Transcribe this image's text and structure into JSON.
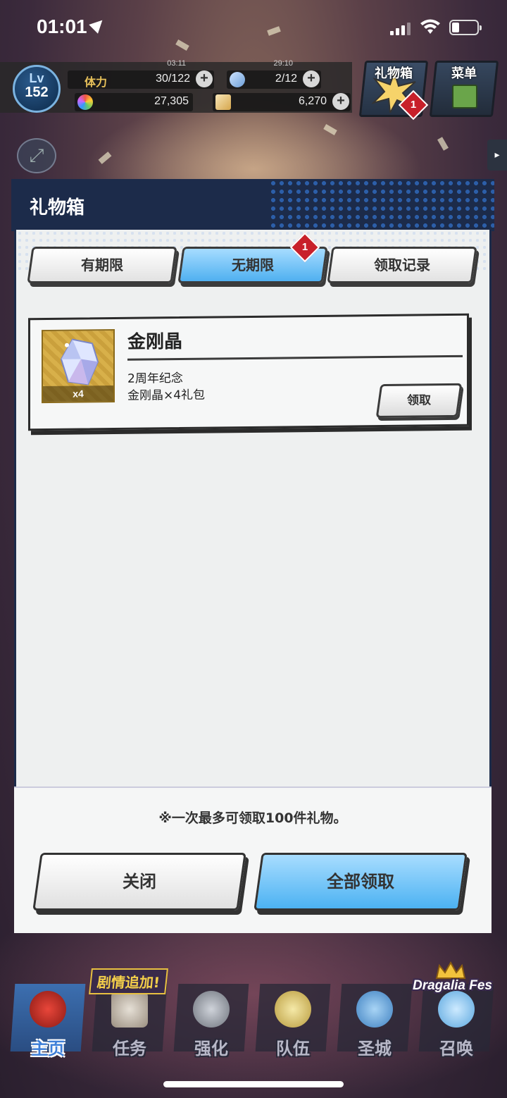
{
  "status_bar": {
    "time": "01:01"
  },
  "hud": {
    "level_label": "Lv",
    "level": "152",
    "stamina_label": "体力",
    "stamina_timer": "03:11",
    "stamina_value": "30/122",
    "wing_timer": "29:10",
    "wing_value": "2/12",
    "rupies": "27,305",
    "wyrmite": "6,270",
    "plus": "+"
  },
  "top_buttons": {
    "gift_label": "礼物箱",
    "gift_badge": "1",
    "menu_label": "菜单"
  },
  "modal": {
    "title": "礼物箱",
    "tabs": [
      {
        "label": "有期限"
      },
      {
        "label": "无期限"
      },
      {
        "label": "领取记录"
      }
    ],
    "active_tab_badge": "1",
    "gift": {
      "name": "金刚晶",
      "quantity": "x4",
      "desc_line1": "2周年纪念",
      "desc_line2": "金刚晶×4礼包",
      "claim_label": "领取"
    },
    "note": "※一次最多可领取100件礼物。",
    "close_label": "关闭",
    "claim_all_label": "全部领取"
  },
  "nav": {
    "story_badge": "剧情追加!",
    "fes_badge": "Dragalia Fes",
    "items": [
      {
        "label": "主页"
      },
      {
        "label": "任务"
      },
      {
        "label": "强化"
      },
      {
        "label": "队伍"
      },
      {
        "label": "圣城"
      },
      {
        "label": "召唤"
      }
    ]
  }
}
